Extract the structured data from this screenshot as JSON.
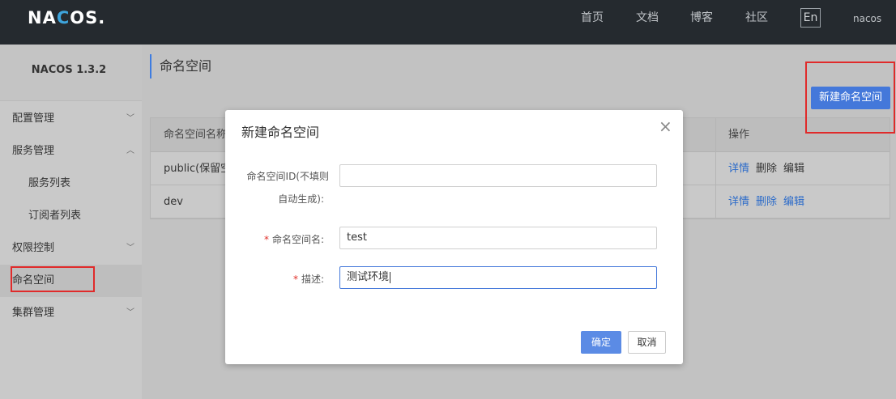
{
  "app": {
    "logo": "NACOS.",
    "version_title": "NACOS 1.3.2"
  },
  "topnav": {
    "items": [
      "首页",
      "文档",
      "博客",
      "社区"
    ],
    "lang": "En",
    "user": "nacos"
  },
  "sidebar": {
    "items": [
      {
        "label": "配置管理",
        "chevron": "chevron-down"
      },
      {
        "label": "服务管理",
        "chevron": "chevron-up"
      },
      {
        "label": "服务列表"
      },
      {
        "label": "订阅者列表"
      },
      {
        "label": "权限控制",
        "chevron": "chevron-down"
      },
      {
        "label": "命名空间"
      },
      {
        "label": "集群管理",
        "chevron": "chevron-down"
      }
    ]
  },
  "main": {
    "title": "命名空间",
    "new_button": "新建命名空间",
    "table": {
      "headers": [
        "命名空间名称",
        "操作"
      ],
      "rows": [
        {
          "name": "public(保留空间",
          "ops": [
            "详情",
            "删除",
            "编辑"
          ]
        },
        {
          "name": "dev",
          "ops": [
            "详情",
            "删除",
            "编辑"
          ]
        }
      ]
    }
  },
  "modal": {
    "title": "新建命名空间",
    "close_icon": "×",
    "id_label_line1": "命名空间ID(不填则",
    "id_label_line2": "自动生成):",
    "id_value": "",
    "name_label": "命名空间名:",
    "name_value": "test",
    "desc_label": "描述:",
    "desc_value": "测试环境",
    "required_mark": "*",
    "ok_button": "确定",
    "cancel_button": "取消"
  },
  "colors": {
    "primary": "#4478da",
    "highlight": "#e02a2a",
    "topbar": "#252a2f"
  }
}
